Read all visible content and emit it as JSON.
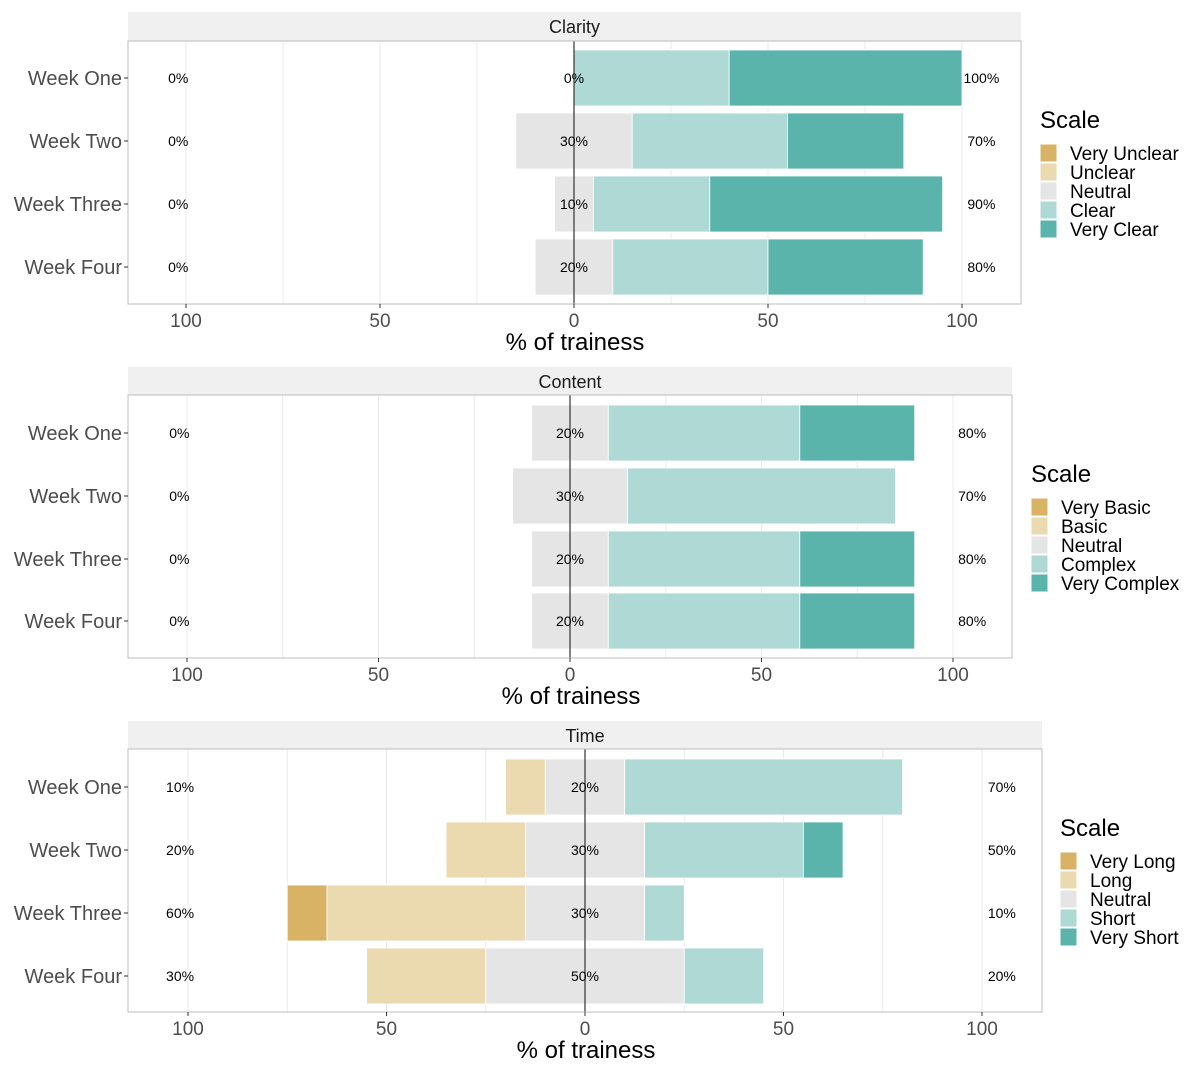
{
  "chart_data": [
    {
      "type": "bar",
      "orientation": "horizontal-diverging-stacked",
      "title": "Clarity",
      "xlabel": "% of trainess",
      "ylabel": "",
      "xlim": [
        -115,
        115
      ],
      "x_ticks": [
        -100,
        -50,
        0,
        50,
        100
      ],
      "x_tick_labels": [
        "100",
        "50",
        "0",
        "50",
        "100"
      ],
      "grid": true,
      "legend": {
        "title": "Scale",
        "position": "right"
      },
      "categories": [
        "Week One",
        "Week Two",
        "Week Three",
        "Week Four"
      ],
      "series": [
        {
          "name": "Very Unclear",
          "color": "#d8b365",
          "values": [
            0,
            0,
            0,
            0
          ]
        },
        {
          "name": "Unclear",
          "color": "#ebd9b0",
          "values": [
            0,
            0,
            0,
            0
          ]
        },
        {
          "name": "Neutral",
          "color": "#e5e5e5",
          "values": [
            0,
            30,
            10,
            20
          ]
        },
        {
          "name": "Clear",
          "color": "#aed9d5",
          "values": [
            40,
            40,
            30,
            40
          ]
        },
        {
          "name": "Very Clear",
          "color": "#5ab4ac",
          "values": [
            60,
            30,
            60,
            40
          ]
        }
      ],
      "labels_left": [
        "0%",
        "0%",
        "0%",
        "0%"
      ],
      "labels_center": [
        "0%",
        "30%",
        "10%",
        "20%"
      ],
      "labels_right": [
        "100%",
        "70%",
        "90%",
        "80%"
      ]
    },
    {
      "type": "bar",
      "orientation": "horizontal-diverging-stacked",
      "title": "Content",
      "xlabel": "% of trainess",
      "ylabel": "",
      "xlim": [
        -115,
        115
      ],
      "x_ticks": [
        -100,
        -50,
        0,
        50,
        100
      ],
      "x_tick_labels": [
        "100",
        "50",
        "0",
        "50",
        "100"
      ],
      "grid": true,
      "legend": {
        "title": "Scale",
        "position": "right"
      },
      "categories": [
        "Week One",
        "Week Two",
        "Week Three",
        "Week Four"
      ],
      "series": [
        {
          "name": "Very Basic",
          "color": "#d8b365",
          "values": [
            0,
            0,
            0,
            0
          ]
        },
        {
          "name": "Basic",
          "color": "#ebd9b0",
          "values": [
            0,
            0,
            0,
            0
          ]
        },
        {
          "name": "Neutral",
          "color": "#e5e5e5",
          "values": [
            20,
            30,
            20,
            20
          ]
        },
        {
          "name": "Complex",
          "color": "#aed9d5",
          "values": [
            50,
            70,
            50,
            50
          ]
        },
        {
          "name": "Very Complex",
          "color": "#5ab4ac",
          "values": [
            30,
            0,
            30,
            30
          ]
        }
      ],
      "labels_left": [
        "0%",
        "0%",
        "0%",
        "0%"
      ],
      "labels_center": [
        "20%",
        "30%",
        "20%",
        "20%"
      ],
      "labels_right": [
        "80%",
        "70%",
        "80%",
        "80%"
      ]
    },
    {
      "type": "bar",
      "orientation": "horizontal-diverging-stacked",
      "title": "Time",
      "xlabel": "% of trainess",
      "ylabel": "",
      "xlim": [
        -115,
        115
      ],
      "x_ticks": [
        -100,
        -50,
        0,
        50,
        100
      ],
      "x_tick_labels": [
        "100",
        "50",
        "0",
        "50",
        "100"
      ],
      "grid": true,
      "legend": {
        "title": "Scale",
        "position": "right"
      },
      "categories": [
        "Week One",
        "Week Two",
        "Week Three",
        "Week Four"
      ],
      "series": [
        {
          "name": "Very Long",
          "color": "#d8b365",
          "values": [
            0,
            0,
            10,
            0
          ]
        },
        {
          "name": "Long",
          "color": "#ebd9b0",
          "values": [
            10,
            20,
            50,
            30
          ]
        },
        {
          "name": "Neutral",
          "color": "#e5e5e5",
          "values": [
            20,
            30,
            30,
            50
          ]
        },
        {
          "name": "Short",
          "color": "#aed9d5",
          "values": [
            70,
            40,
            10,
            20
          ]
        },
        {
          "name": "Very Short",
          "color": "#5ab4ac",
          "values": [
            0,
            10,
            0,
            0
          ]
        }
      ],
      "labels_left": [
        "10%",
        "20%",
        "60%",
        "30%"
      ],
      "labels_center": [
        "20%",
        "30%",
        "30%",
        "50%"
      ],
      "labels_right": [
        "70%",
        "50%",
        "10%",
        "20%"
      ]
    }
  ]
}
